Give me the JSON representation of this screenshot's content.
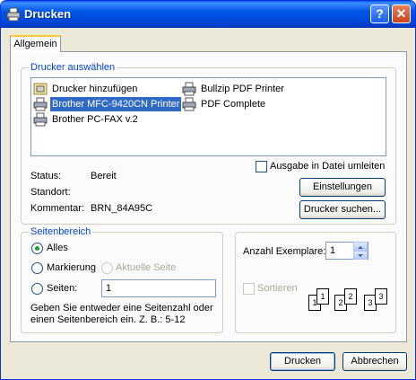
{
  "window": {
    "title": "Drucken",
    "help_label": "?",
    "close_label": "✕"
  },
  "tabs": [
    {
      "label": "Allgemein"
    }
  ],
  "printer_group": {
    "legend": "Drucker auswählen",
    "printers": [
      {
        "label": "Drucker hinzufügen",
        "icon": "add-printer-icon"
      },
      {
        "label": "Brother MFC-9420CN Printer",
        "icon": "printer-icon",
        "selected": true
      },
      {
        "label": "Brother PC-FAX v.2",
        "icon": "printer-icon"
      },
      {
        "label": "Bullzip PDF Printer",
        "icon": "printer-icon"
      },
      {
        "label": "PDF Complete",
        "icon": "printer-icon"
      }
    ],
    "status_label": "Status:",
    "status_value": "Bereit",
    "location_label": "Standort:",
    "location_value": "",
    "comment_label": "Kommentar:",
    "comment_value": "BRN_84A95C",
    "print_to_file_label": "Ausgabe in Datei umleiten",
    "settings_button": "Einstellungen",
    "find_printer_button": "Drucker suchen..."
  },
  "page_range": {
    "legend": "Seitenbereich",
    "all_label": "Alles",
    "selection_label": "Markierung",
    "current_page_label": "Aktuelle Seite",
    "pages_label": "Seiten:",
    "pages_value": "1",
    "hint": "Geben Sie entweder eine Seitenzahl oder einen Seitenbereich ein. Z. B.: 5-12"
  },
  "copies": {
    "count_label": "Anzahl Exemplare:",
    "count_value": "1",
    "collate_label": "Sortieren",
    "collate_pages": [
      "1",
      "1",
      "2",
      "2",
      "3",
      "3"
    ]
  },
  "footer": {
    "print_button": "Drucken",
    "cancel_button": "Abbrechen"
  },
  "colors": {
    "titlebar": "#0055e5",
    "selection": "#316ac5",
    "group_legend": "#0046d5"
  }
}
